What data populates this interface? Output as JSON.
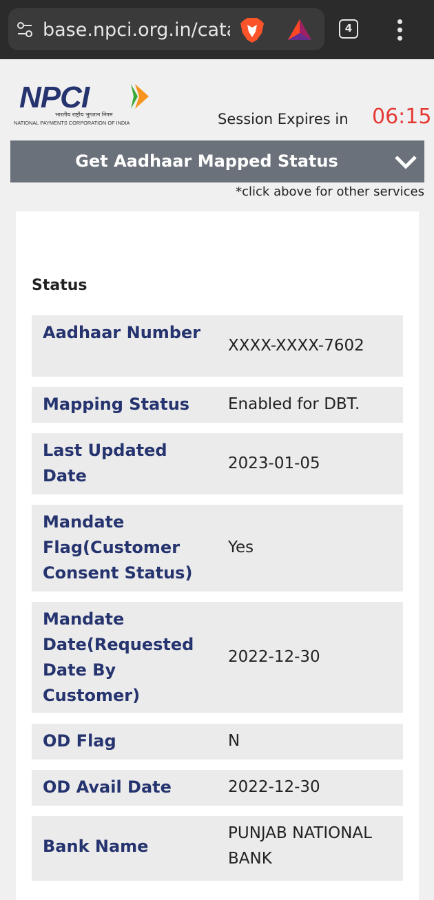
{
  "browser": {
    "url": "base.npci.org.in/catalo",
    "tab_count": "4"
  },
  "header": {
    "logo_name": "NPCI",
    "logo_hindi": "भारतीय राष्ट्रीय भुगतान निगम",
    "logo_subtitle": "NATIONAL PAYMENTS CORPORATION OF INDIA",
    "session_label": "Session Expires in",
    "session_time": "06:15"
  },
  "service": {
    "title": "Get Aadhaar Mapped Status",
    "hint": "*click above for other services"
  },
  "status": {
    "heading": "Status",
    "rows": [
      {
        "label": "Aadhaar Number",
        "value": "XXXX-XXXX-7602"
      },
      {
        "label": "Mapping Status",
        "value": "Enabled for DBT."
      },
      {
        "label": "Last Updated Date",
        "value": "2023-01-05"
      },
      {
        "label": "Mandate Flag(Customer Consent Status)",
        "value": "Yes"
      },
      {
        "label": "Mandate Date(Requested Date By Customer)",
        "value": "2022-12-30"
      },
      {
        "label": "OD Flag",
        "value": "N"
      },
      {
        "label": "OD Avail Date",
        "value": "2022-12-30"
      },
      {
        "label": "Bank Name",
        "value": "PUNJAB NATIONAL BANK"
      }
    ]
  },
  "colors": {
    "accent_red": "#e53935",
    "label_navy": "#25336e",
    "bar_gray": "#6b717a"
  }
}
